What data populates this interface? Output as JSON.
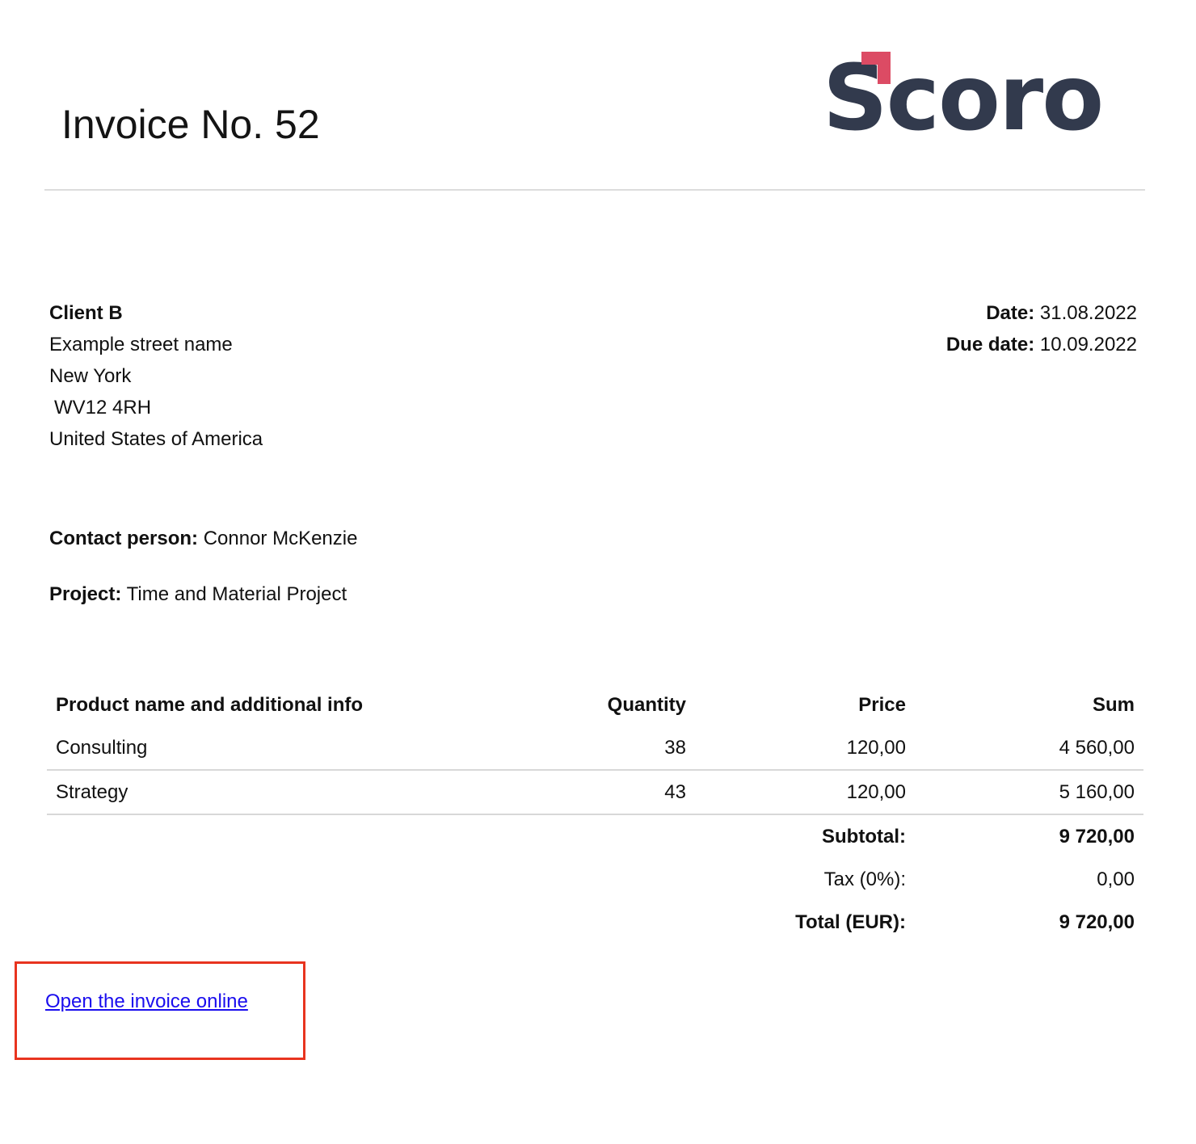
{
  "invoice": {
    "title": "Invoice No. 52"
  },
  "logo": {
    "text": "Scoro",
    "colors": {
      "word": "#323a4d",
      "mark": "#dc4b64"
    }
  },
  "client": {
    "name": "Client B",
    "street": "Example street name",
    "city": "New York",
    "postcode": "WV12 4RH",
    "country": "United States of America"
  },
  "dates": {
    "date_label": "Date:",
    "date_value": "31.08.2022",
    "due_label": "Due date:",
    "due_value": "10.09.2022"
  },
  "contact": {
    "label": "Contact person:",
    "value": "Connor McKenzie"
  },
  "project": {
    "label": "Project:",
    "value": "Time and Material Project"
  },
  "table": {
    "headers": {
      "product": "Product name and additional info",
      "quantity": "Quantity",
      "price": "Price",
      "sum": "Sum"
    },
    "rows": [
      {
        "product": "Consulting",
        "quantity": "38",
        "price": "120,00",
        "sum": "4 560,00"
      },
      {
        "product": "Strategy",
        "quantity": "43",
        "price": "120,00",
        "sum": "5 160,00"
      }
    ],
    "subtotal_label": "Subtotal:",
    "subtotal_value": "9 720,00",
    "tax_label": "Tax (0%):",
    "tax_value": "0,00",
    "total_label": "Total (EUR):",
    "total_value": "9 720,00"
  },
  "link": {
    "text": "Open the invoice online",
    "color": "#1a0dee",
    "highlight_color": "#e8341f"
  }
}
